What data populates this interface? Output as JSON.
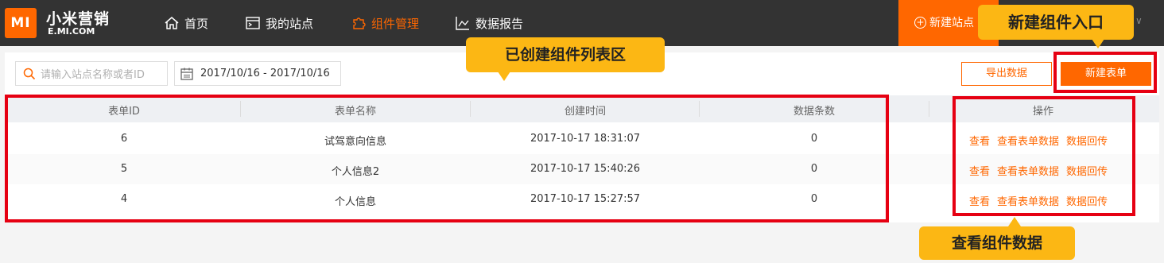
{
  "header": {
    "logo_text": "MI",
    "brand_cn": "小米营销",
    "brand_en": "E.MI.COM",
    "nav": [
      {
        "label": "首页",
        "icon": "home-icon"
      },
      {
        "label": "我的站点",
        "icon": "site-terminal-icon"
      },
      {
        "label": "组件管理",
        "icon": "puzzle-icon"
      },
      {
        "label": "数据报告",
        "icon": "chart-icon"
      }
    ],
    "active_nav": "组件管理",
    "new_site_label": "新建站点",
    "accent_color": "#ff6700"
  },
  "toolbar": {
    "search_placeholder": "请输入站点名称或者ID",
    "date_range": "2017/10/16 - 2017/10/16",
    "export_label": "导出数据",
    "new_form_label": "新建表单"
  },
  "table": {
    "columns": [
      "表单ID",
      "表单名称",
      "创建时间",
      "数据条数",
      "操作"
    ],
    "rows": [
      {
        "id": "6",
        "name": "试驾意向信息",
        "created": "2017-10-17 18:31:07",
        "count": "0"
      },
      {
        "id": "5",
        "name": "个人信息2",
        "created": "2017-10-17 15:40:26",
        "count": "0"
      },
      {
        "id": "4",
        "name": "个人信息",
        "created": "2017-10-17 15:27:57",
        "count": "0"
      }
    ],
    "actions": [
      "查看",
      "查看表单数据",
      "数据回传"
    ]
  },
  "annotations": {
    "list_area": "已创建组件列表区",
    "new_entry": "新建组件入口",
    "view_data": "查看组件数据",
    "highlight_color": "#e60012",
    "callout_color": "#fcb714"
  }
}
